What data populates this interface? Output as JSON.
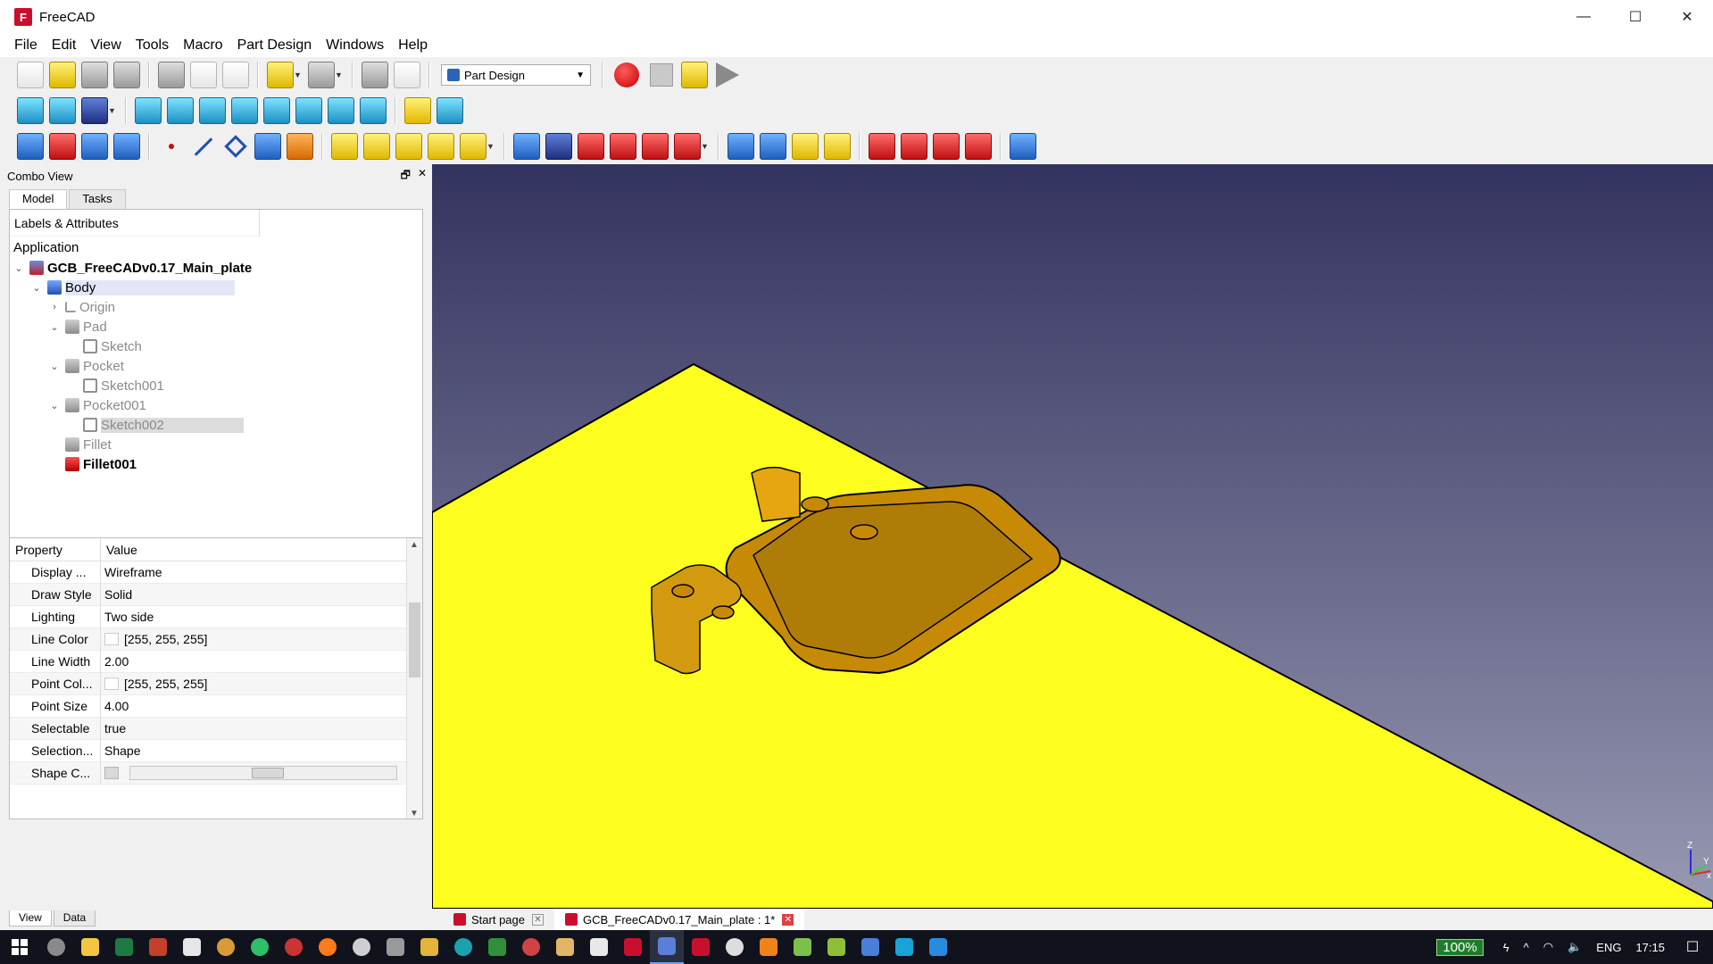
{
  "window": {
    "title": "FreeCAD",
    "minimize": "—",
    "maximize": "☐",
    "close": "✕",
    "app_icon_letter": "F"
  },
  "menu": [
    "File",
    "Edit",
    "View",
    "Tools",
    "Macro",
    "Part Design",
    "Windows",
    "Help"
  ],
  "toolbar": {
    "workbench": "Part Design"
  },
  "combo_view": {
    "title": "Combo View",
    "float_btn": "🗗",
    "close_btn": "✕",
    "tabs": [
      "Model",
      "Tasks"
    ],
    "tree_header": "Labels & Attributes",
    "application_label": "Application",
    "tree": [
      {
        "label": "GCB_FreeCADv0.17_Main_plate",
        "icon": "document-icon"
      },
      {
        "label": "Body",
        "icon": "body-icon"
      },
      {
        "label": "Origin",
        "icon": "origin-icon"
      },
      {
        "label": "Pad",
        "icon": "pad-icon"
      },
      {
        "label": "Sketch",
        "icon": "sketch-icon"
      },
      {
        "label": "Pocket",
        "icon": "pocket-icon"
      },
      {
        "label": "Sketch001",
        "icon": "sketch-icon"
      },
      {
        "label": "Pocket001",
        "icon": "pocket-icon"
      },
      {
        "label": "Sketch002",
        "icon": "sketch-icon"
      },
      {
        "label": "Fillet",
        "icon": "fillet-icon"
      },
      {
        "label": "Fillet001",
        "icon": "fillet-icon"
      }
    ]
  },
  "properties": {
    "col_property": "Property",
    "col_value": "Value",
    "rows": [
      {
        "name": "Display ...",
        "value": "Wireframe"
      },
      {
        "name": "Draw Style",
        "value": "Solid"
      },
      {
        "name": "Lighting",
        "value": "Two side"
      },
      {
        "name": "Line Color",
        "value": "[255, 255, 255]"
      },
      {
        "name": "Line Width",
        "value": "2.00"
      },
      {
        "name": "Point Col...",
        "value": "[255, 255, 255]"
      },
      {
        "name": "Point Size",
        "value": "4.00"
      },
      {
        "name": "Selectable",
        "value": "true"
      },
      {
        "name": "Selection...",
        "value": "Shape"
      },
      {
        "name": "Shape C...",
        "value": ""
      }
    ],
    "tabs": [
      "View",
      "Data"
    ]
  },
  "doc_tabs": [
    {
      "label": "Start page"
    },
    {
      "label": "GCB_FreeCADv0.17_Main_plate : 1*"
    }
  ],
  "axis": {
    "x": "x",
    "y": "Y",
    "z": "Z"
  },
  "taskbar": {
    "battery": "100%",
    "language": "ENG",
    "time": "17:15"
  },
  "colors": {
    "plate": "#ffff1f",
    "pocket": "#c68a06",
    "background_top": "#33335f",
    "background_bottom": "#9899b2"
  }
}
